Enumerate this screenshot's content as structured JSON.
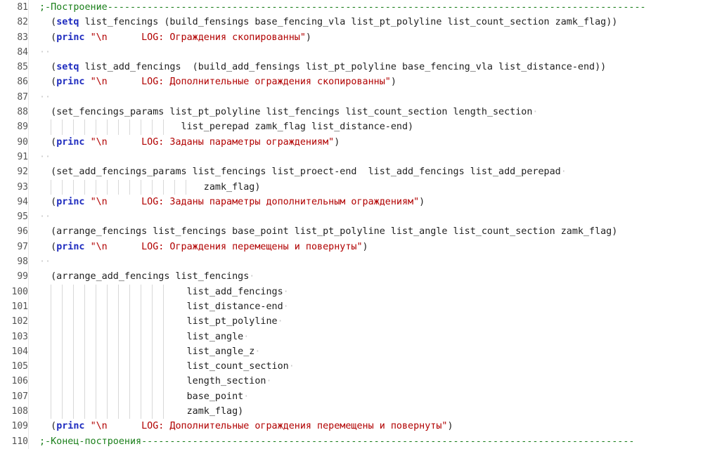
{
  "lines": [
    {
      "n": "81",
      "parts": [
        {
          "t": ";-Построение-----------------------------------------------------------------------------------------------",
          "c": "cmt"
        }
      ]
    },
    {
      "n": "82",
      "parts": [
        {
          "t": "  ("
        },
        {
          "t": "setq",
          "c": "kw"
        },
        {
          "t": " list_fencings (build_fensings base_fencing_vla list_pt_polyline list_count_section zamk_flag))"
        }
      ]
    },
    {
      "n": "83",
      "parts": [
        {
          "t": "  ("
        },
        {
          "t": "princ",
          "c": "kw"
        },
        {
          "t": " "
        },
        {
          "t": "\"\\n      LOG: Ограждения скопированны\"",
          "c": "str"
        },
        {
          "t": ")"
        }
      ]
    },
    {
      "n": "84",
      "parts": [
        {
          "t": "··",
          "c": "dot"
        }
      ]
    },
    {
      "n": "85",
      "parts": [
        {
          "t": "  ("
        },
        {
          "t": "setq",
          "c": "kw"
        },
        {
          "t": " list_add_fencings  (build_add_fensings list_pt_polyline base_fencing_vla list_distance-end))"
        }
      ]
    },
    {
      "n": "86",
      "parts": [
        {
          "t": "  ("
        },
        {
          "t": "princ",
          "c": "kw"
        },
        {
          "t": " "
        },
        {
          "t": "\"\\n      LOG: Дополнительные ограждения скопированны\"",
          "c": "str"
        },
        {
          "t": ")"
        }
      ]
    },
    {
      "n": "87",
      "parts": [
        {
          "t": "··",
          "c": "dot"
        }
      ]
    },
    {
      "n": "88",
      "parts": [
        {
          "t": "  (set_fencings_params list_pt_polyline list_fencings list_count_section length_section"
        },
        {
          "t": "·",
          "c": "dot"
        }
      ]
    },
    {
      "n": "89",
      "parts": [
        {
          "t": "                         list_perepad zamk_flag list_distance-end)"
        }
      ]
    },
    {
      "n": "90",
      "parts": [
        {
          "t": "  ("
        },
        {
          "t": "princ",
          "c": "kw"
        },
        {
          "t": " "
        },
        {
          "t": "\"\\n      LOG: Заданы параметры ограждениям\"",
          "c": "str"
        },
        {
          "t": ")"
        }
      ]
    },
    {
      "n": "91",
      "parts": [
        {
          "t": "··",
          "c": "dot"
        }
      ]
    },
    {
      "n": "92",
      "parts": [
        {
          "t": "  (set_add_fencings_params list_fencings list_proect-end  list_add_fencings list_add_perepad"
        },
        {
          "t": "·",
          "c": "dot"
        }
      ]
    },
    {
      "n": "93",
      "parts": [
        {
          "t": "                             zamk_flag)"
        }
      ]
    },
    {
      "n": "94",
      "parts": [
        {
          "t": "  ("
        },
        {
          "t": "princ",
          "c": "kw"
        },
        {
          "t": " "
        },
        {
          "t": "\"\\n      LOG: Заданы параметры дополнительным ограждениям\"",
          "c": "str"
        },
        {
          "t": ")"
        }
      ]
    },
    {
      "n": "95",
      "parts": [
        {
          "t": "··",
          "c": "dot"
        }
      ]
    },
    {
      "n": "96",
      "parts": [
        {
          "t": "  (arrange_fencings list_fencings base_point list_pt_polyline list_angle list_count_section zamk_flag)"
        }
      ]
    },
    {
      "n": "97",
      "parts": [
        {
          "t": "  ("
        },
        {
          "t": "princ",
          "c": "kw"
        },
        {
          "t": " "
        },
        {
          "t": "\"\\n      LOG: Ограждения перемещены и повернуты\"",
          "c": "str"
        },
        {
          "t": ")"
        }
      ]
    },
    {
      "n": "98",
      "parts": [
        {
          "t": "··",
          "c": "dot"
        }
      ]
    },
    {
      "n": "99",
      "parts": [
        {
          "t": "  (arrange_add_fencings list_fencings"
        },
        {
          "t": "·",
          "c": "dot"
        }
      ]
    },
    {
      "n": "100",
      "parts": [
        {
          "t": "                          list_add_fencings"
        },
        {
          "t": "·",
          "c": "dot"
        }
      ]
    },
    {
      "n": "101",
      "parts": [
        {
          "t": "                          list_distance-end"
        },
        {
          "t": "·",
          "c": "dot"
        }
      ]
    },
    {
      "n": "102",
      "parts": [
        {
          "t": "                          list_pt_polyline"
        },
        {
          "t": "·",
          "c": "dot"
        }
      ]
    },
    {
      "n": "103",
      "parts": [
        {
          "t": "                          list_angle"
        },
        {
          "t": "·",
          "c": "dot"
        }
      ]
    },
    {
      "n": "104",
      "parts": [
        {
          "t": "                          list_angle_z"
        },
        {
          "t": "·",
          "c": "dot"
        }
      ]
    },
    {
      "n": "105",
      "parts": [
        {
          "t": "                          list_count_section"
        },
        {
          "t": "·",
          "c": "dot"
        }
      ]
    },
    {
      "n": "106",
      "parts": [
        {
          "t": "                          length_section"
        },
        {
          "t": "·",
          "c": "dot"
        }
      ]
    },
    {
      "n": "107",
      "parts": [
        {
          "t": "                          base_point"
        },
        {
          "t": "·",
          "c": "dot"
        }
      ]
    },
    {
      "n": "108",
      "parts": [
        {
          "t": "                          zamk_flag)"
        }
      ]
    },
    {
      "n": "109",
      "parts": [
        {
          "t": "  ("
        },
        {
          "t": "princ",
          "c": "kw"
        },
        {
          "t": " "
        },
        {
          "t": "\"\\n      LOG: Дополнительные ограждения перемещены и повернуты\"",
          "c": "str"
        },
        {
          "t": ")"
        }
      ]
    },
    {
      "n": "110",
      "parts": [
        {
          "t": ";-Конец-построения---------------------------------------------------------------------------------------",
          "c": "cmt"
        }
      ]
    }
  ],
  "colors": {
    "keyword": "#1e2bbf",
    "string": "#b10000",
    "comment": "#1a7f1a",
    "line_number": "#555555"
  }
}
